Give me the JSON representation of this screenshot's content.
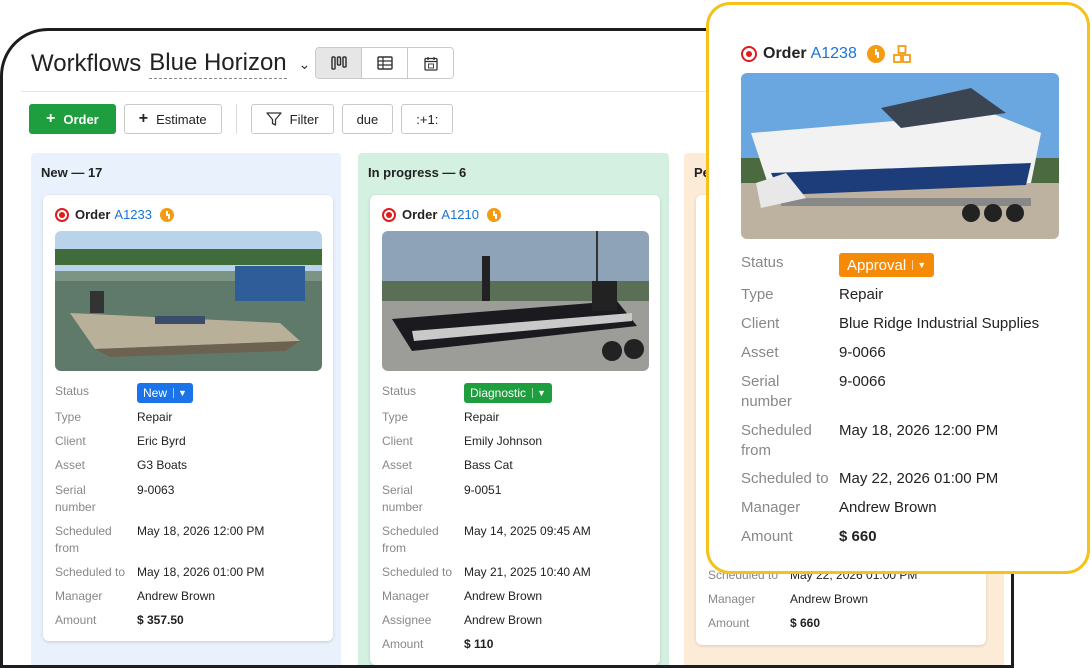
{
  "header": {
    "title": "Workflows",
    "workspace": "Blue Horizon",
    "views": [
      "kanban-icon",
      "table-icon",
      "calendar-icon"
    ]
  },
  "toolbar": {
    "order_label": "Order",
    "estimate_label": "Estimate",
    "filter_label": "Filter",
    "due_label": "due",
    "tag_label": ":+1:"
  },
  "columns": [
    {
      "title": "New — 17",
      "color": "#e8f1fc",
      "card": {
        "order_prefix": "Order",
        "order_no": "A1233",
        "status": "New",
        "status_color": "#1a73e8",
        "fields": [
          {
            "label": "Status",
            "value": "New"
          },
          {
            "label": "Type",
            "value": "Repair"
          },
          {
            "label": "Client",
            "value": "Eric Byrd"
          },
          {
            "label": "Asset",
            "value": "G3 Boats"
          },
          {
            "label": "Serial number",
            "value": "9-0063"
          },
          {
            "label": "Scheduled from",
            "value": "May 18, 2026 12:00 PM"
          },
          {
            "label": "Scheduled to",
            "value": "May 18, 2026 01:00 PM"
          },
          {
            "label": "Manager",
            "value": "Andrew Brown"
          },
          {
            "label": "Amount",
            "value": "$ 357.50"
          }
        ]
      }
    },
    {
      "title": "In progress — 6",
      "color": "#d4f0e0",
      "card": {
        "order_prefix": "Order",
        "order_no": "A1210",
        "status": "Diagnostic",
        "status_color": "#1e9e3e",
        "fields": [
          {
            "label": "Status",
            "value": "Diagnostic"
          },
          {
            "label": "Type",
            "value": "Repair"
          },
          {
            "label": "Client",
            "value": "Emily Johnson"
          },
          {
            "label": "Asset",
            "value": "Bass Cat"
          },
          {
            "label": "Serial number",
            "value": "9-0051"
          },
          {
            "label": "Scheduled from",
            "value": "May 14, 2025 09:45 AM"
          },
          {
            "label": "Scheduled to",
            "value": "May 21, 2025 10:40 AM"
          },
          {
            "label": "Manager",
            "value": "Andrew Brown"
          },
          {
            "label": "Assignee",
            "value": "Andrew Brown"
          },
          {
            "label": "Amount",
            "value": "$ 110"
          }
        ]
      }
    },
    {
      "title": "Pe",
      "color": "#fcecd7",
      "card": {
        "fields": [
          {
            "label": "Scheduled to",
            "value": "May 22, 2026 01:00 PM"
          },
          {
            "label": "Manager",
            "value": "Andrew Brown"
          },
          {
            "label": "Amount",
            "value": "$ 660"
          }
        ]
      }
    }
  ],
  "popup": {
    "order_prefix": "Order",
    "order_no": "A1238",
    "status": "Approval",
    "status_color": "#f58a07",
    "fields": [
      {
        "label": "Status",
        "value": "Approval"
      },
      {
        "label": "Type",
        "value": "Repair"
      },
      {
        "label": "Client",
        "value": "Blue Ridge Industrial Supplies"
      },
      {
        "label": "Asset",
        "value": "9-0066"
      },
      {
        "label": "Serial number",
        "value": "9-0066"
      },
      {
        "label": "Scheduled from",
        "value": "May 18, 2026 12:00 PM"
      },
      {
        "label": "Scheduled to",
        "value": "May 22, 2026 01:00 PM"
      },
      {
        "label": "Manager",
        "value": "Andrew Brown"
      },
      {
        "label": "Amount",
        "value": "$ 660"
      }
    ]
  }
}
